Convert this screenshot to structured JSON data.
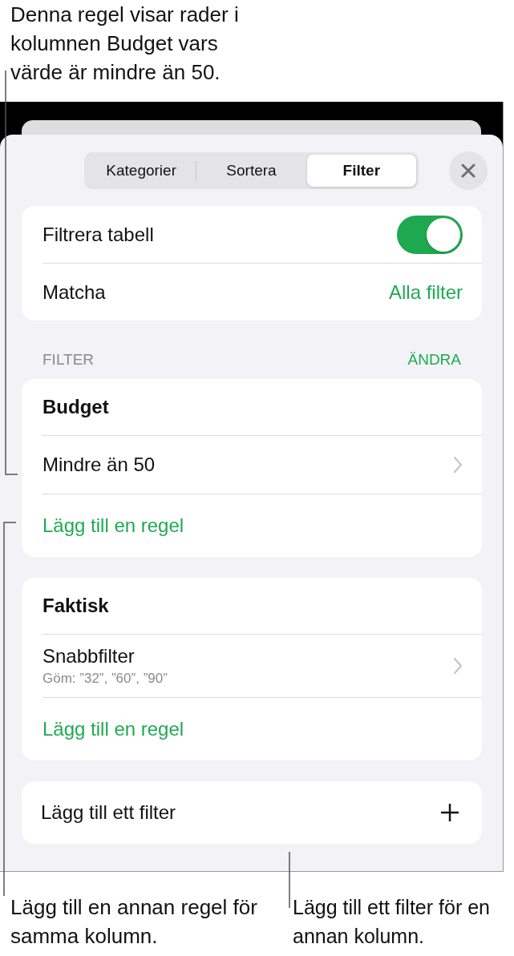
{
  "callouts": [
    "Denna regel visar rader i kolumnen Budget vars värde är mindre än 50.",
    "Lägg till en annan regel för samma kolumn.",
    "Lägg till ett filter för en annan kolumn."
  ],
  "tabs": [
    {
      "label": "Kategorier",
      "selected": false
    },
    {
      "label": "Sortera",
      "selected": false
    },
    {
      "label": "Filter",
      "selected": true
    }
  ],
  "table_filter": {
    "label": "Filtrera tabell",
    "on": true
  },
  "match": {
    "label": "Matcha",
    "value": "Alla filter"
  },
  "section": {
    "title": "FILTER",
    "action": "ÄNDRA"
  },
  "filters": [
    {
      "column": "Budget",
      "rules": [
        {
          "title": "Mindre än 50"
        }
      ],
      "add_rule": "Lägg till en regel"
    },
    {
      "column": "Faktisk",
      "rules": [
        {
          "title": "Snabbfilter",
          "detail": "Göm: ”32”, ”60”, ”90”"
        }
      ],
      "add_rule": "Lägg till en regel"
    }
  ],
  "add_filter": "Lägg till ett filter"
}
